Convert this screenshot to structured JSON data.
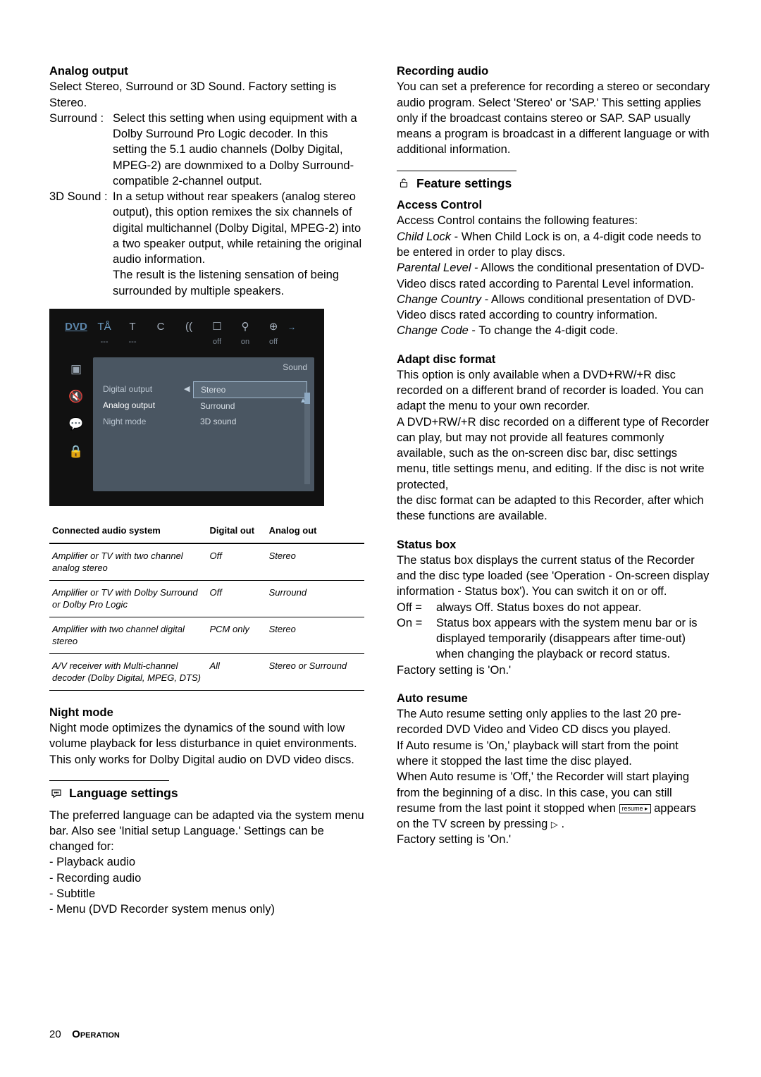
{
  "left": {
    "analog_output_h": "Analog output",
    "analog_output_intro": "Select Stereo, Surround or 3D Sound. Factory setting is Stereo.",
    "surround_label": "Surround :",
    "surround_text": "Select this setting when using equipment with a Dolby Surround Pro Logic decoder. In this setting the 5.1 audio channels (Dolby Digital, MPEG-2) are downmixed to a Dolby Surround-compatible 2-channel output.",
    "sd_label": "3D Sound :",
    "sd_text1": "In a setup without rear speakers (analog stereo output), this option remixes the six channels of digital multichannel (Dolby Digital, MPEG-2) into a two speaker output, while retaining the original audio information.",
    "sd_text2": "The result is the listening sensation of being surrounded by multiple speakers.",
    "osd": {
      "dvd": "DVD",
      "tabs": [
        "TÅ",
        "T",
        "C",
        "((",
        "☐",
        "⚲",
        "⊕"
      ],
      "tabs2": [
        "",
        "---",
        "---",
        "",
        "off",
        "on",
        "off"
      ],
      "sound_label": "Sound",
      "menu": {
        "digital": "Digital output",
        "analog": "Analog output",
        "night": "Night mode"
      },
      "options": [
        "Stereo",
        "Surround",
        "3D sound"
      ],
      "side": [
        "▣",
        "🔇",
        "💬",
        "🔒"
      ]
    },
    "tbl": {
      "h1": "Connected audio system",
      "h2": "Digital out",
      "h3": "Analog out",
      "rows": [
        {
          "a": "Amplifier or TV with two channel analog stereo",
          "b": "Off",
          "c": "Stereo"
        },
        {
          "a": "Amplifier or TV with Dolby Surround or Dolby Pro Logic",
          "b": "Off",
          "c": "Surround"
        },
        {
          "a": "Amplifier with two channel digital stereo",
          "b": "PCM only",
          "c": "Stereo"
        },
        {
          "a": "A/V receiver with Multi-channel decoder (Dolby Digital, MPEG, DTS)",
          "b": "All",
          "c": "Stereo or Surround"
        }
      ]
    },
    "night_h": "Night mode",
    "night_p": "Night mode optimizes the dynamics of the sound with low volume playback for less disturbance in quiet environments. This only works for Dolby Digital audio on DVD video discs.",
    "lang_h": "Language settings",
    "lang_p": "The preferred language can be adapted via the system menu bar. Also see 'Initial setup Language.' Settings can be changed for:",
    "lang_items": [
      "Playback audio",
      "Recording audio",
      "Subtitle",
      "Menu (DVD Recorder system menus only)"
    ]
  },
  "right": {
    "rec_h": "Recording audio",
    "rec_p": "You can set a preference for recording a stereo or secondary audio program. Select 'Stereo' or 'SAP.' This setting applies only if the broadcast contains stereo or SAP. SAP usually means a program is broadcast in a different language or with additional information.",
    "feat_h": "Feature settings",
    "ac_h": "Access Control",
    "ac_intro": "Access Control contains the following features:",
    "ac_child_l": "Child Lock",
    "ac_child_t": " - When Child Lock is on, a 4-digit code needs to be entered in order to play discs.",
    "ac_par_l": "Parental Level",
    "ac_par_t": " - Allows the conditional presentation of DVD-Video discs rated according to Parental Level information.",
    "ac_cc_l": "Change Country",
    "ac_cc_t": " - Allows conditional presentation of DVD-Video discs rated according to country information.",
    "ac_code_l": "Change Code",
    "ac_code_t": " - To change the 4-digit code.",
    "adapt_h": "Adapt disc format",
    "adapt_p1": "This option is only available when a DVD+RW/+R disc recorded on a different brand of recorder is loaded. You can adapt the menu to your own recorder.",
    "adapt_p2": "A DVD+RW/+R disc recorded on a different type of Recorder can play, but may not provide all features commonly available, such as the on-screen disc bar, disc settings menu, title settings menu, and editing. If the disc is not write protected,",
    "adapt_p3": "the disc format can be adapted to this Recorder, after which these functions are available.",
    "status_h": "Status box",
    "status_p": "The status box displays the current status of the Recorder and the disc type loaded (see 'Operation - On-screen display information - Status box'). You can switch it on or off.",
    "status_off_l": "Off =",
    "status_off_t": "always Off. Status boxes do not appear.",
    "status_on_l": "On =",
    "status_on_t": "Status box appears with the system menu bar or is displayed temporarily (disappears after time-out) when changing the playback or record status.",
    "status_foot": "Factory setting is 'On.'",
    "auto_h": "Auto resume",
    "auto_p1": "The Auto resume setting only applies to the last 20 pre-recorded DVD Video and Video CD discs you played.",
    "auto_p2": "If Auto resume is 'On,' playback will start from the point where it stopped the last time the disc played.",
    "auto_p3a": "When Auto resume is 'Off,' the Recorder will start playing from the beginning of a disc. In this case, you can still resume from the last point it stopped when ",
    "auto_p3b": " appears on the TV screen by pressing ",
    "auto_p3c": " .",
    "auto_foot": "Factory setting is 'On.'",
    "resume_glyph": "resume ▸",
    "play_glyph": "▷"
  },
  "footer": {
    "page": "20",
    "section": "Operation"
  }
}
